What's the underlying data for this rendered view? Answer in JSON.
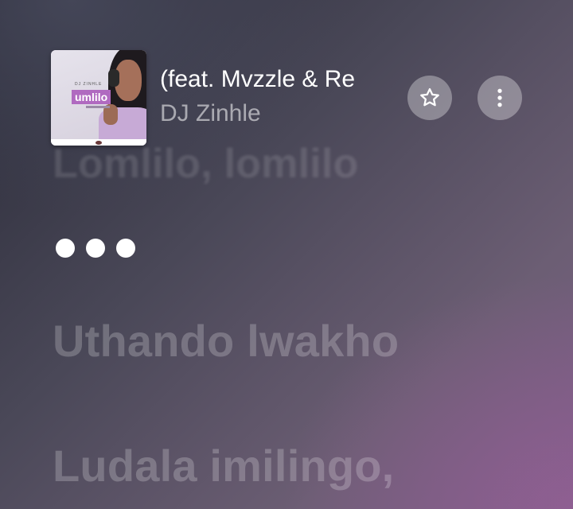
{
  "now_playing": {
    "title": "(feat. Mvzzle & Re",
    "artist": "DJ Zinhle",
    "artwork": {
      "title_text": "umlilo",
      "small_text": "DJ ZINHLE"
    }
  },
  "buttons": {
    "favorite_icon": "star-outline-icon",
    "more_icon": "more-vertical-icon"
  },
  "lyrics": {
    "previous_line": "Lomlilo, lomlilo",
    "waiting_indicator": "three-dots",
    "lines": [
      "Uthando lwakho",
      "Ludala imilingo,",
      ""
    ]
  },
  "colors": {
    "active_text": "#ffffff",
    "inactive_lyric": "rgba(255,255,255,0.22)",
    "background_start": "#2a2b38",
    "background_end": "#7a5e86",
    "artwork_accent": "#b06ac0"
  }
}
